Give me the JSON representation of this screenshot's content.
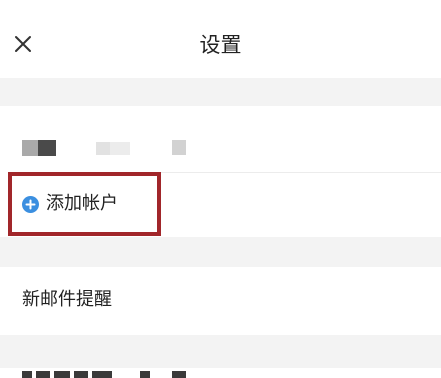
{
  "header": {
    "title": "设置",
    "close_icon": "close-icon"
  },
  "account": {
    "redacted": true
  },
  "add_account": {
    "label": "添加帐户",
    "icon": "plus-circle-icon",
    "icon_color": "#3b8fe0",
    "highlight_color": "#a1262a"
  },
  "new_mail_reminder": {
    "label": "新邮件提醒"
  },
  "colors": {
    "background": "#ffffff",
    "section_gap": "#f3f3f3",
    "text": "#222222"
  }
}
